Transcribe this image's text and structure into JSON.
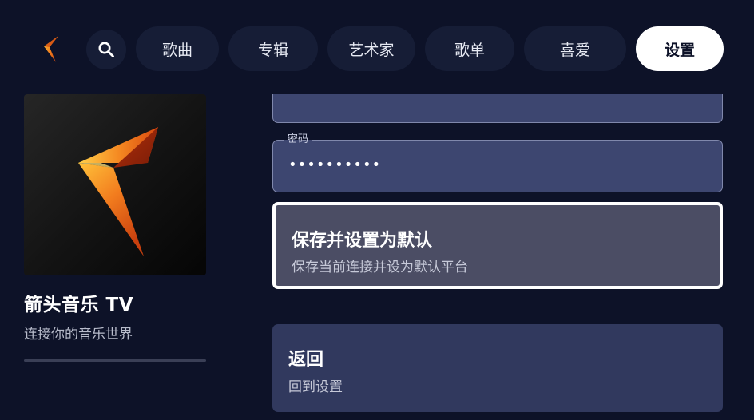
{
  "app": {
    "name": "箭头音乐 TV",
    "tagline": "连接你的音乐世界"
  },
  "nav": {
    "tabs": [
      {
        "label": "歌曲"
      },
      {
        "label": "专辑"
      },
      {
        "label": "艺术家"
      },
      {
        "label": "歌单"
      },
      {
        "label": "喜爱"
      },
      {
        "label": "设置"
      }
    ],
    "active_tab": "设置"
  },
  "form": {
    "password": {
      "label": "密码",
      "value": "••••••••••"
    }
  },
  "actions": {
    "save": {
      "title": "保存并设置为默认",
      "subtitle": "保存当前连接并设为默认平台"
    },
    "back": {
      "title": "返回",
      "subtitle": "回到设置"
    }
  },
  "icons": {
    "logo": "arrow-logo-icon",
    "search": "search-icon"
  },
  "colors": {
    "background": "#0d1228",
    "nav_tab": "#161d36",
    "field": "#3d4670",
    "focused_card": "#4b4d64",
    "card": "#31395e",
    "logo_orange": "#f07a1c"
  }
}
